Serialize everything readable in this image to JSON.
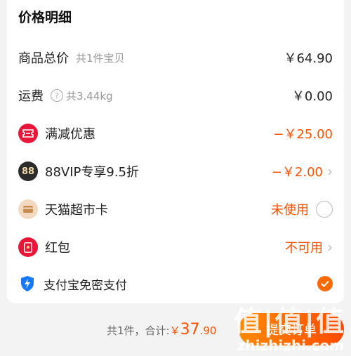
{
  "title": "价格明细",
  "rows": {
    "goods": {
      "label": "商品总价",
      "sub": "共1件宝贝",
      "value": "￥64.90"
    },
    "shipping": {
      "label": "运费",
      "sub": "共3.44kg",
      "value": "￥0.00"
    },
    "discount": {
      "label": "满减优惠",
      "value": "−￥25.00"
    },
    "vip": {
      "label": "88VIP专享9.5折",
      "icon_text": "88",
      "value": "−￥2.00"
    },
    "card": {
      "label": "天猫超市卡",
      "value": "未使用"
    },
    "redpacket": {
      "label": "红包",
      "value": "不可用"
    },
    "alipay": {
      "label": "支付宝免密支付",
      "checked": true
    }
  },
  "footer": {
    "count": "共1件，",
    "total_label": "合计:",
    "currency": "￥",
    "amount_int": "37",
    "amount_dec": ".90",
    "submit_label": "提交订单"
  },
  "watermark": {
    "main": "值|值|值",
    "site": "zhizhizhi.com"
  },
  "colors": {
    "accent": "#ff5000",
    "discount_icon": "#e8173a",
    "vip_icon": "#2b2b2b",
    "card_icon": "#f3d9c0",
    "alipay": "#1677ff"
  }
}
